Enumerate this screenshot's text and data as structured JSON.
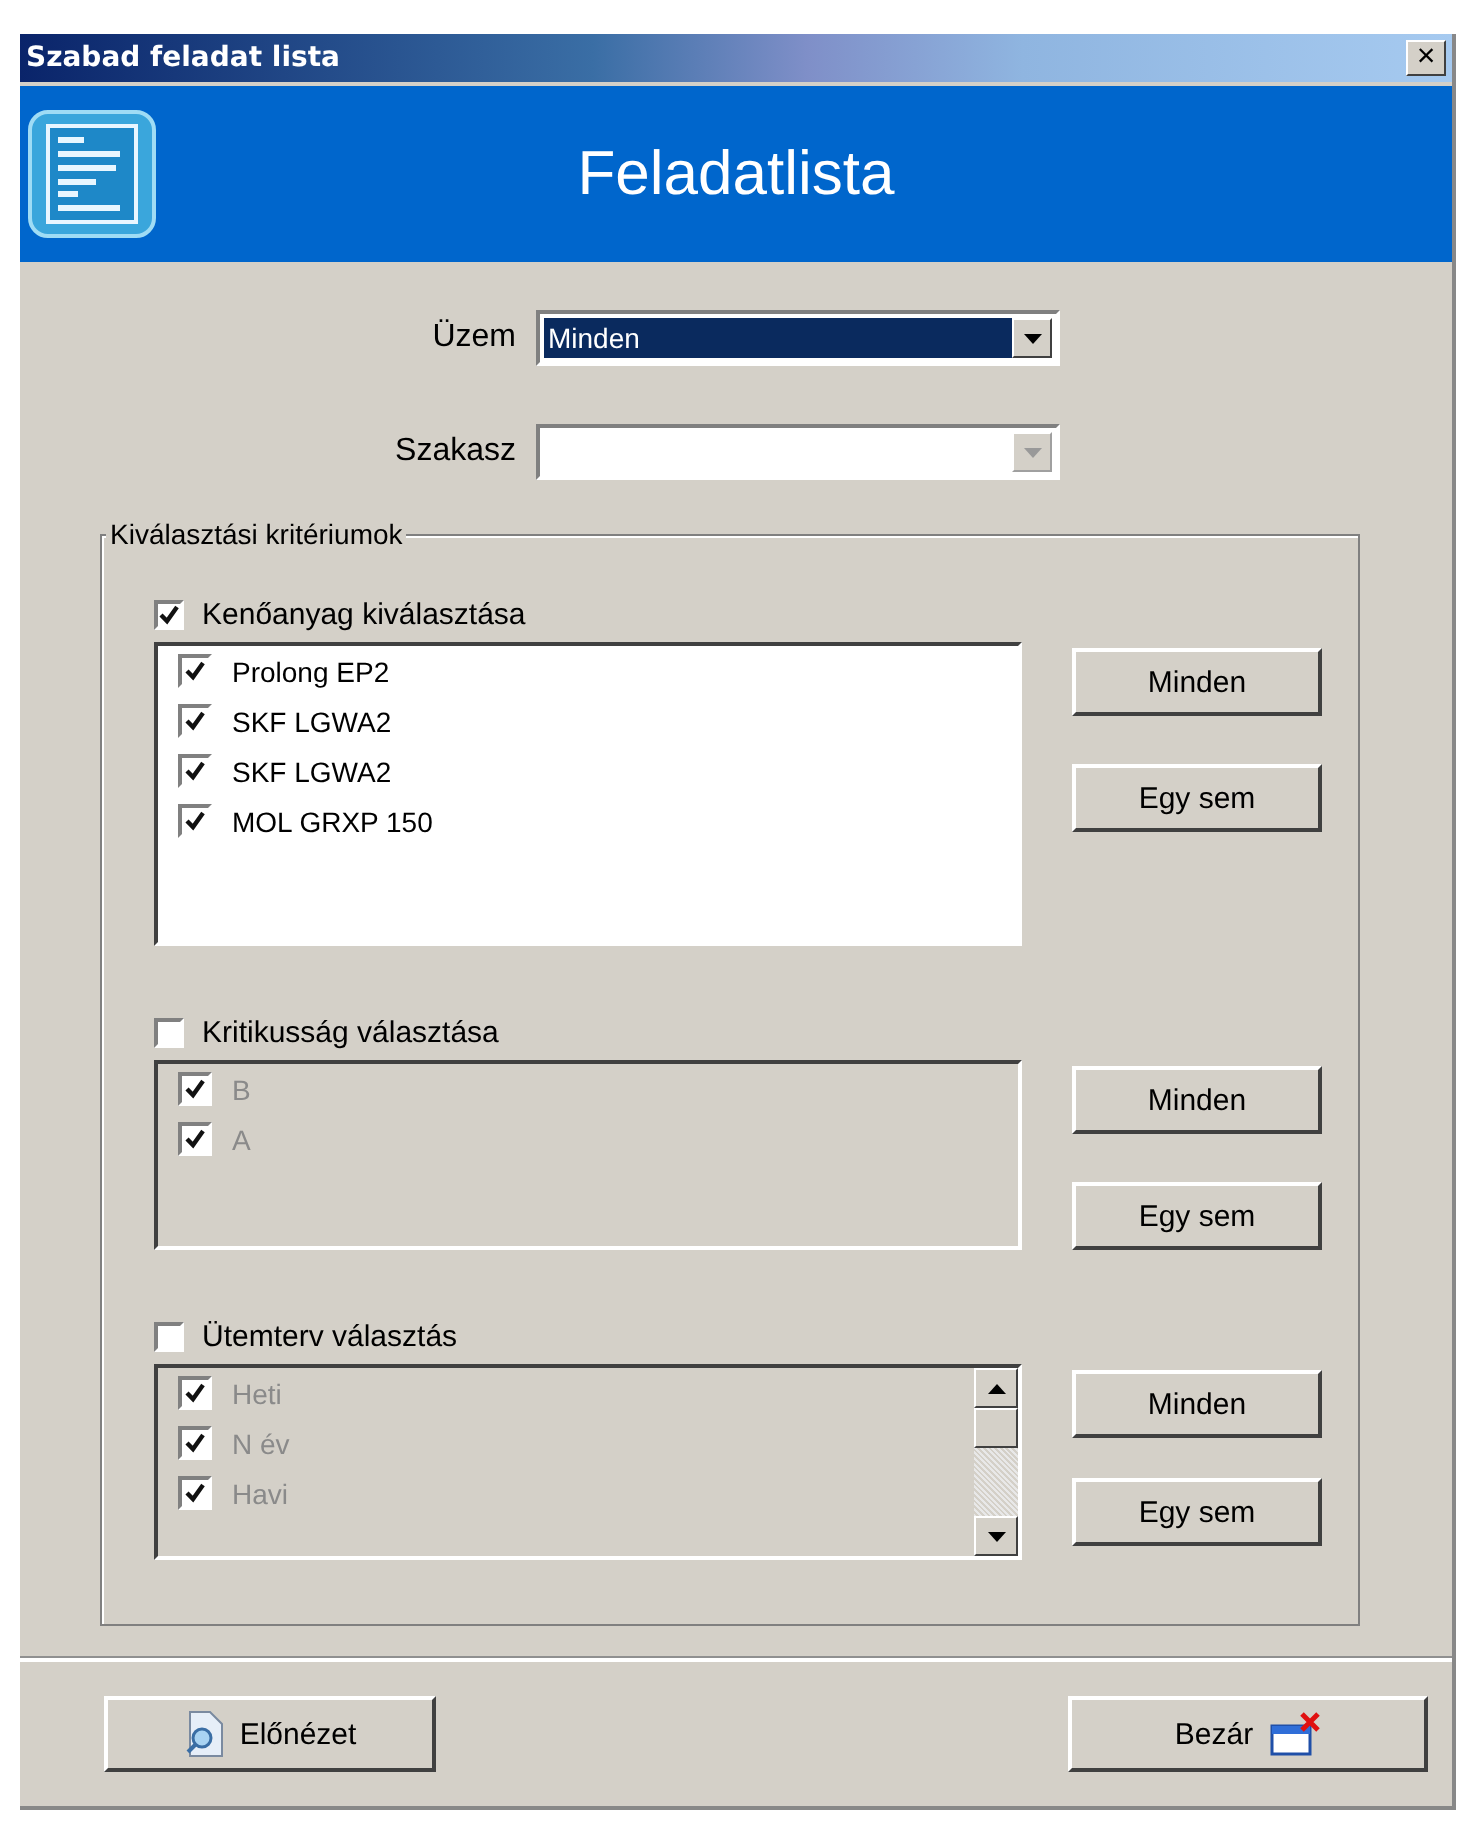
{
  "window": {
    "title": "Szabad feladat lista",
    "close": "×"
  },
  "header": {
    "title": "Feladatlista"
  },
  "fields": [
    {
      "label": "Üzem",
      "value": "Minden",
      "selected": true,
      "disabled": false
    },
    {
      "label": "Szakasz",
      "selected": false,
      "disabled": true
    }
  ],
  "criteria": {
    "legend": "Kiválasztási kritériumok",
    "sections": [
      {
        "label": "Kenőanyag kiválasztása",
        "checked": true,
        "scrollable": false,
        "items": [
          {
            "label": "Prolong EP2",
            "checked": true
          },
          {
            "label": "SKF LGWA2",
            "checked": true
          },
          {
            "label": "SKF LGWA2",
            "checked": true
          },
          {
            "label": "MOL GRXP 150",
            "checked": true
          }
        ],
        "buttons": [
          "Minden",
          "Egy sem"
        ]
      },
      {
        "label": "Kritikusság választása",
        "checked": false,
        "scrollable": false,
        "items": [
          {
            "label": "B",
            "checked": true
          },
          {
            "label": "A",
            "checked": true
          }
        ],
        "buttons": [
          "Minden",
          "Egy sem"
        ]
      },
      {
        "label": "Ütemterv választás",
        "checked": false,
        "scrollable": true,
        "items": [
          {
            "label": "Heti",
            "checked": true
          },
          {
            "label": "N év",
            "checked": true
          },
          {
            "label": "Havi",
            "checked": true
          }
        ],
        "buttons": [
          "Minden",
          "Egy sem"
        ]
      }
    ]
  },
  "footer": {
    "buttons": [
      {
        "label": "Előnézet",
        "kind": "preview"
      },
      {
        "label": "Bezár",
        "kind": "close"
      }
    ]
  }
}
